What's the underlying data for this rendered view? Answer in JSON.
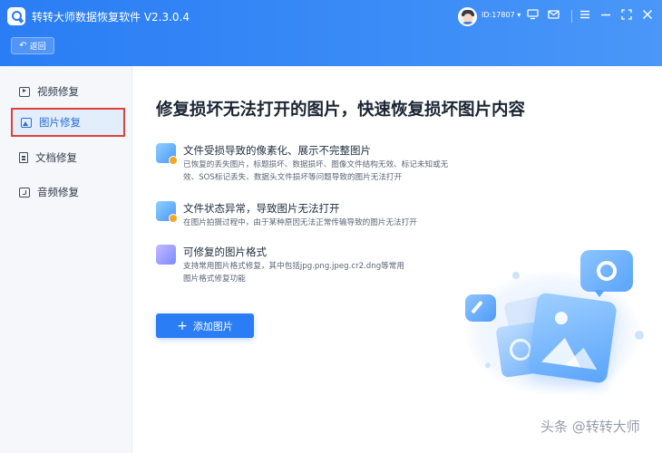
{
  "app": {
    "title": "转转大师数据恢复软件 V2.3.0.4",
    "back_label": "返回",
    "user_id": "ID:17807",
    "dropdown_arrow": "▾"
  },
  "header_icons": [
    "monitor-icon",
    "mail-icon",
    "help-icon",
    "menu-icon",
    "minimize-icon",
    "maximize-icon",
    "close-icon"
  ],
  "sidebar": {
    "items": [
      {
        "label": "视频修复",
        "icon": "video-icon",
        "active": false
      },
      {
        "label": "图片修复",
        "icon": "image-icon",
        "active": true
      },
      {
        "label": "文档修复",
        "icon": "document-icon",
        "active": false
      },
      {
        "label": "音频修复",
        "icon": "audio-icon",
        "active": false
      }
    ]
  },
  "main": {
    "title": "修复损坏无法打开的图片，快速恢复损坏图片内容",
    "features": [
      {
        "title": "文件受损导致的像素化、展示不完整图片",
        "description": "已恢复的丢失图片，标题损坏、数据损坏、图像文件结构无效、标记未知或无效、SOS标记丢失、数据头文件损坏等问题导致的图片无法打开"
      },
      {
        "title": "文件状态异常，导致图片无法打开",
        "description": "在图片拍摄过程中，由于某种原因无法正常传输导致的图片无法打开"
      },
      {
        "title": "可修复的图片格式",
        "description": "支持常用图片格式修复，其中包括jpg.png.jpeg.cr2.dng等常用图片格式修复功能"
      }
    ],
    "add_button_label": "添加图片",
    "add_button_icon": "plus-icon"
  },
  "watermark": "头条 @转转大师",
  "colors": {
    "accent": "#2a7df4",
    "active_highlight_border": "#e0403a",
    "active_item_bg": "#e3eefc"
  }
}
